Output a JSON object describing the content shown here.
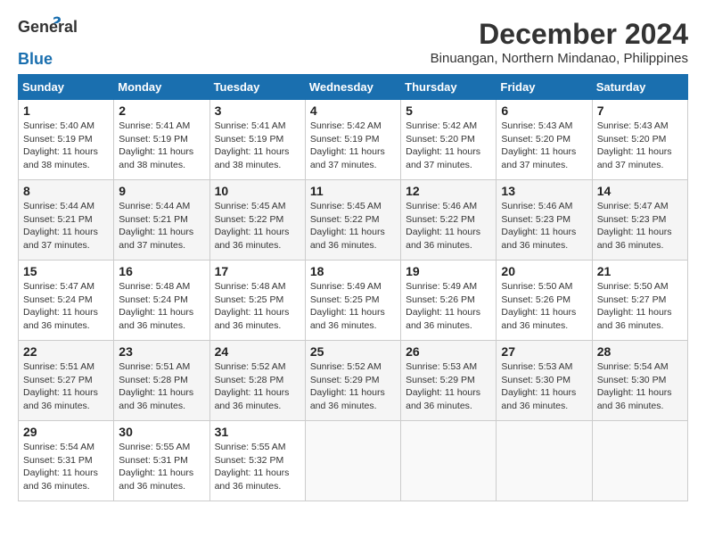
{
  "logo": {
    "general": "General",
    "blue": "Blue"
  },
  "title": "December 2024",
  "location": "Binuangan, Northern Mindanao, Philippines",
  "days_of_week": [
    "Sunday",
    "Monday",
    "Tuesday",
    "Wednesday",
    "Thursday",
    "Friday",
    "Saturday"
  ],
  "weeks": [
    [
      {
        "day": "1",
        "sunrise": "Sunrise: 5:40 AM",
        "sunset": "Sunset: 5:19 PM",
        "daylight": "Daylight: 11 hours and 38 minutes."
      },
      {
        "day": "2",
        "sunrise": "Sunrise: 5:41 AM",
        "sunset": "Sunset: 5:19 PM",
        "daylight": "Daylight: 11 hours and 38 minutes."
      },
      {
        "day": "3",
        "sunrise": "Sunrise: 5:41 AM",
        "sunset": "Sunset: 5:19 PM",
        "daylight": "Daylight: 11 hours and 38 minutes."
      },
      {
        "day": "4",
        "sunrise": "Sunrise: 5:42 AM",
        "sunset": "Sunset: 5:19 PM",
        "daylight": "Daylight: 11 hours and 37 minutes."
      },
      {
        "day": "5",
        "sunrise": "Sunrise: 5:42 AM",
        "sunset": "Sunset: 5:20 PM",
        "daylight": "Daylight: 11 hours and 37 minutes."
      },
      {
        "day": "6",
        "sunrise": "Sunrise: 5:43 AM",
        "sunset": "Sunset: 5:20 PM",
        "daylight": "Daylight: 11 hours and 37 minutes."
      },
      {
        "day": "7",
        "sunrise": "Sunrise: 5:43 AM",
        "sunset": "Sunset: 5:20 PM",
        "daylight": "Daylight: 11 hours and 37 minutes."
      }
    ],
    [
      {
        "day": "8",
        "sunrise": "Sunrise: 5:44 AM",
        "sunset": "Sunset: 5:21 PM",
        "daylight": "Daylight: 11 hours and 37 minutes."
      },
      {
        "day": "9",
        "sunrise": "Sunrise: 5:44 AM",
        "sunset": "Sunset: 5:21 PM",
        "daylight": "Daylight: 11 hours and 37 minutes."
      },
      {
        "day": "10",
        "sunrise": "Sunrise: 5:45 AM",
        "sunset": "Sunset: 5:22 PM",
        "daylight": "Daylight: 11 hours and 36 minutes."
      },
      {
        "day": "11",
        "sunrise": "Sunrise: 5:45 AM",
        "sunset": "Sunset: 5:22 PM",
        "daylight": "Daylight: 11 hours and 36 minutes."
      },
      {
        "day": "12",
        "sunrise": "Sunrise: 5:46 AM",
        "sunset": "Sunset: 5:22 PM",
        "daylight": "Daylight: 11 hours and 36 minutes."
      },
      {
        "day": "13",
        "sunrise": "Sunrise: 5:46 AM",
        "sunset": "Sunset: 5:23 PM",
        "daylight": "Daylight: 11 hours and 36 minutes."
      },
      {
        "day": "14",
        "sunrise": "Sunrise: 5:47 AM",
        "sunset": "Sunset: 5:23 PM",
        "daylight": "Daylight: 11 hours and 36 minutes."
      }
    ],
    [
      {
        "day": "15",
        "sunrise": "Sunrise: 5:47 AM",
        "sunset": "Sunset: 5:24 PM",
        "daylight": "Daylight: 11 hours and 36 minutes."
      },
      {
        "day": "16",
        "sunrise": "Sunrise: 5:48 AM",
        "sunset": "Sunset: 5:24 PM",
        "daylight": "Daylight: 11 hours and 36 minutes."
      },
      {
        "day": "17",
        "sunrise": "Sunrise: 5:48 AM",
        "sunset": "Sunset: 5:25 PM",
        "daylight": "Daylight: 11 hours and 36 minutes."
      },
      {
        "day": "18",
        "sunrise": "Sunrise: 5:49 AM",
        "sunset": "Sunset: 5:25 PM",
        "daylight": "Daylight: 11 hours and 36 minutes."
      },
      {
        "day": "19",
        "sunrise": "Sunrise: 5:49 AM",
        "sunset": "Sunset: 5:26 PM",
        "daylight": "Daylight: 11 hours and 36 minutes."
      },
      {
        "day": "20",
        "sunrise": "Sunrise: 5:50 AM",
        "sunset": "Sunset: 5:26 PM",
        "daylight": "Daylight: 11 hours and 36 minutes."
      },
      {
        "day": "21",
        "sunrise": "Sunrise: 5:50 AM",
        "sunset": "Sunset: 5:27 PM",
        "daylight": "Daylight: 11 hours and 36 minutes."
      }
    ],
    [
      {
        "day": "22",
        "sunrise": "Sunrise: 5:51 AM",
        "sunset": "Sunset: 5:27 PM",
        "daylight": "Daylight: 11 hours and 36 minutes."
      },
      {
        "day": "23",
        "sunrise": "Sunrise: 5:51 AM",
        "sunset": "Sunset: 5:28 PM",
        "daylight": "Daylight: 11 hours and 36 minutes."
      },
      {
        "day": "24",
        "sunrise": "Sunrise: 5:52 AM",
        "sunset": "Sunset: 5:28 PM",
        "daylight": "Daylight: 11 hours and 36 minutes."
      },
      {
        "day": "25",
        "sunrise": "Sunrise: 5:52 AM",
        "sunset": "Sunset: 5:29 PM",
        "daylight": "Daylight: 11 hours and 36 minutes."
      },
      {
        "day": "26",
        "sunrise": "Sunrise: 5:53 AM",
        "sunset": "Sunset: 5:29 PM",
        "daylight": "Daylight: 11 hours and 36 minutes."
      },
      {
        "day": "27",
        "sunrise": "Sunrise: 5:53 AM",
        "sunset": "Sunset: 5:30 PM",
        "daylight": "Daylight: 11 hours and 36 minutes."
      },
      {
        "day": "28",
        "sunrise": "Sunrise: 5:54 AM",
        "sunset": "Sunset: 5:30 PM",
        "daylight": "Daylight: 11 hours and 36 minutes."
      }
    ],
    [
      {
        "day": "29",
        "sunrise": "Sunrise: 5:54 AM",
        "sunset": "Sunset: 5:31 PM",
        "daylight": "Daylight: 11 hours and 36 minutes."
      },
      {
        "day": "30",
        "sunrise": "Sunrise: 5:55 AM",
        "sunset": "Sunset: 5:31 PM",
        "daylight": "Daylight: 11 hours and 36 minutes."
      },
      {
        "day": "31",
        "sunrise": "Sunrise: 5:55 AM",
        "sunset": "Sunset: 5:32 PM",
        "daylight": "Daylight: 11 hours and 36 minutes."
      },
      null,
      null,
      null,
      null
    ]
  ]
}
